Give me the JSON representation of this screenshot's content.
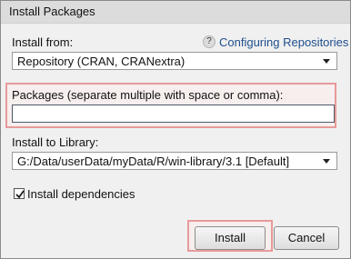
{
  "window": {
    "title": "Install Packages"
  },
  "install_from": {
    "label": "Install from:",
    "help_icon_text": "?",
    "help_link": "Configuring Repositories",
    "selected": "Repository (CRAN, CRANextra)"
  },
  "packages": {
    "label": "Packages (separate multiple with space or comma):",
    "value": ""
  },
  "library": {
    "label": "Install to Library:",
    "selected": "G:/Data/userData/myData/R/win-library/3.1 [Default]"
  },
  "dependencies": {
    "label": "Install dependencies",
    "checked": true
  },
  "buttons": {
    "install": "Install",
    "cancel": "Cancel"
  },
  "colors": {
    "highlight": "#e79a9a",
    "link": "#1f4e8d"
  }
}
